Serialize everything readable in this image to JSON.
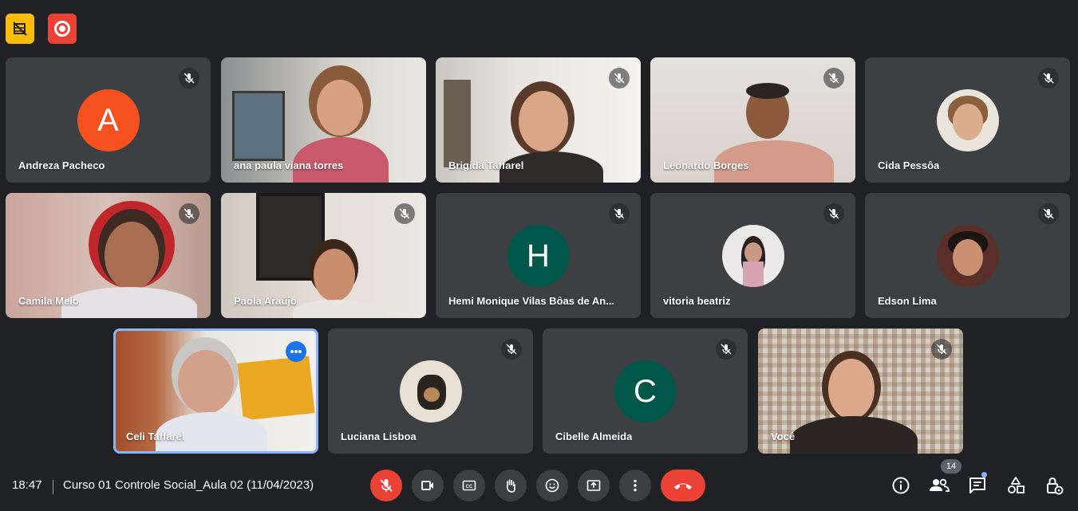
{
  "colors": {
    "background": "#202124",
    "tile": "#3c4043",
    "red": "#ea4335",
    "yellow": "#fbbc04",
    "teal": "#01584a",
    "orange": "#f4511e",
    "blue": "#1a73e8"
  },
  "top_badges": [
    {
      "icon": "no-video-layout-icon"
    },
    {
      "icon": "recording-icon"
    }
  ],
  "participants": [
    {
      "name": "Andreza Pacheco",
      "avatar_letter": "A"
    },
    {
      "name": "ana paula viana torres"
    },
    {
      "name": "Brigida Taffarel"
    },
    {
      "name": "Leonardo Borges"
    },
    {
      "name": "Cida Pessôa"
    },
    {
      "name": "Camila Melo"
    },
    {
      "name": "Paola Araújo"
    },
    {
      "name": "Hemi Monique Vilas Bôas de An...",
      "avatar_letter": "H"
    },
    {
      "name": "vitoria beatriz"
    },
    {
      "name": "Edson Lima"
    },
    {
      "name": "Celi Taffarel"
    },
    {
      "name": "Luciana Lisboa"
    },
    {
      "name": "Cibelle Almeida",
      "avatar_letter": "C"
    },
    {
      "name": "Você"
    }
  ],
  "bottom_bar": {
    "time": "18:47",
    "meeting_title": "Curso 01 Controle Social_Aula 02 (11/04/2023)",
    "participant_count": "14"
  }
}
